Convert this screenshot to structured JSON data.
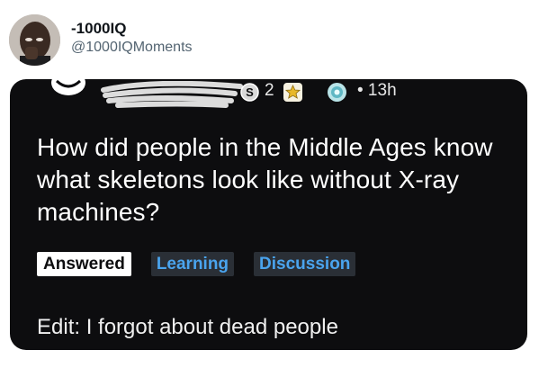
{
  "tweet": {
    "display_name": "-1000IQ",
    "handle": "@1000IQMoments",
    "avatar_icon": "thinking-man-avatar"
  },
  "post": {
    "author_redacted": "u/",
    "award_silver_count": "2",
    "time": "• 13h",
    "title": "How did people in the Middle Ages know what skeletons look like without X-ray machines?",
    "flairs": {
      "answered": "Answered",
      "learning": "Learning",
      "discussion": "Discussion"
    },
    "edit_text": "Edit: I forgot about dead people",
    "colors": {
      "card_bg": "#0d0d0f",
      "flair_text": "#4aa4ee",
      "flair_bg": "#2a2f36"
    },
    "icons": [
      "reddit-icon",
      "silver-award-icon",
      "gold-award-icon",
      "platinum-award-icon"
    ]
  }
}
